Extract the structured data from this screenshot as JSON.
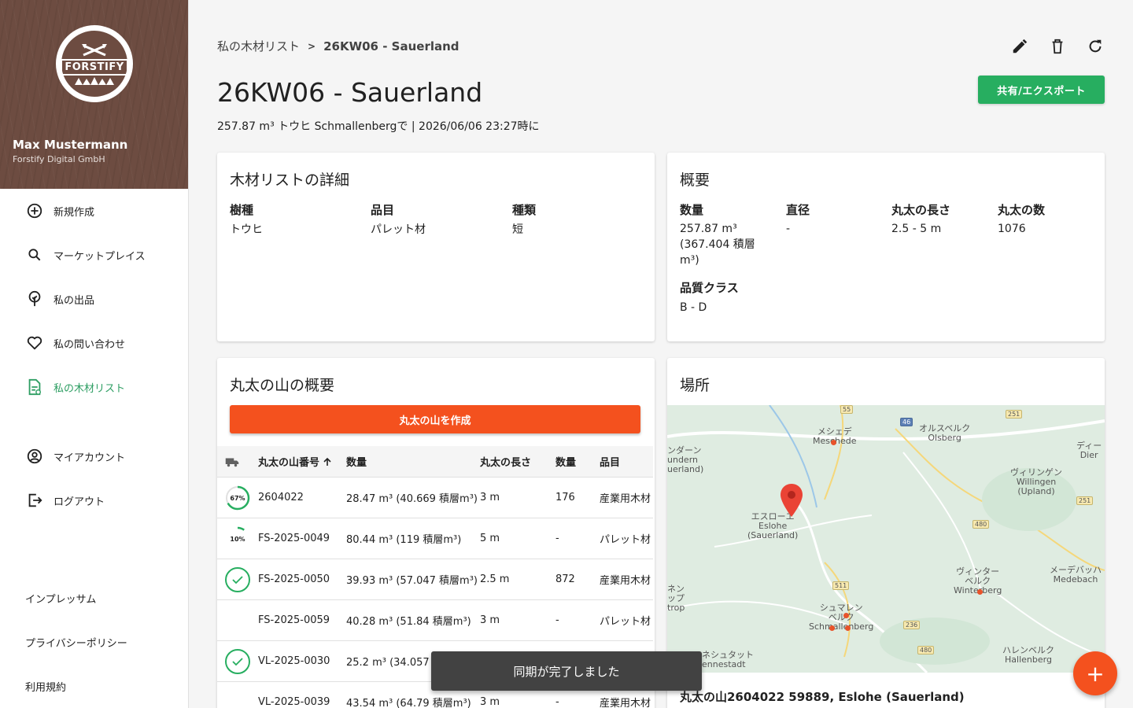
{
  "colors": {
    "brand_brown": "#6d4c41",
    "accent_green": "#27ae60",
    "accent_orange": "#f4511e"
  },
  "sidebar": {
    "logo_text": "FORSTIFY",
    "user_name": "Max Mustermann",
    "user_company": "Forstify Digital GmbH",
    "items": [
      {
        "label": "新規作成",
        "icon": "add-circle-icon"
      },
      {
        "label": "マーケットプレイス",
        "icon": "search-icon"
      },
      {
        "label": "私の出品",
        "icon": "tree-icon"
      },
      {
        "label": "私の問い合わせ",
        "icon": "heart-icon"
      },
      {
        "label": "私の木材リスト",
        "icon": "document-icon"
      },
      {
        "label": "マイアカウント",
        "icon": "account-icon"
      },
      {
        "label": "ログアウト",
        "icon": "logout-icon"
      }
    ],
    "footer": [
      "インプレッサム",
      "プライバシーポリシー",
      "利用規約"
    ]
  },
  "breadcrumb": {
    "parent": "私の木材リスト",
    "separator": ">",
    "current": "26KW06 - Sauerland"
  },
  "header": {
    "title": "26KW06 - Sauerland",
    "subtitle": "257.87 m³ トウヒ Schmallenbergで | 2026/06/06 23:27時に",
    "share_label": "共有/エクスポート"
  },
  "details": {
    "title": "木材リストの詳細",
    "fields": [
      {
        "label": "樹種",
        "value": "トウヒ"
      },
      {
        "label": "品目",
        "value": "パレット材"
      },
      {
        "label": "種類",
        "value": "短"
      }
    ]
  },
  "summary": {
    "title": "概要",
    "quantity_label": "数量",
    "quantity_value": "257.87 m³ (367.404 積層 m³)",
    "diameter_label": "直径",
    "diameter_value": "-",
    "length_label": "丸太の長さ",
    "length_value": "2.5 - 5 m",
    "count_label": "丸太の数",
    "count_value": "1076",
    "quality_label": "品質クラス",
    "quality_value": "B - D"
  },
  "piles": {
    "title": "丸太の山の概要",
    "create_label": "丸太の山を作成",
    "headers": {
      "number": "丸太の山番号",
      "volume": "数量",
      "length": "丸太の長さ",
      "count": "数量",
      "item": "品目"
    },
    "rows": [
      {
        "status": "67%",
        "progress": 0.67,
        "number": "2604022",
        "volume": "28.47 m³ (40.669 積層m³)",
        "length": "3 m",
        "count": "176",
        "item": "産業用木材"
      },
      {
        "status": "10%",
        "progress": 0.1,
        "number": "FS-2025-0049",
        "volume": "80.44 m³ (119 積層m³)",
        "length": "5 m",
        "count": "-",
        "item": "パレット材"
      },
      {
        "status": "done",
        "number": "FS-2025-0050",
        "volume": "39.93 m³ (57.047 積層m³)",
        "length": "2.5 m",
        "count": "872",
        "item": "産業用木材"
      },
      {
        "status": "",
        "number": "FS-2025-0059",
        "volume": "40.28 m³ (51.84 積層m³)",
        "length": "3 m",
        "count": "-",
        "item": "パレット材"
      },
      {
        "status": "done",
        "number": "VL-2025-0030",
        "volume": "25.2 m³ (34.057 積層m³)",
        "length": "",
        "count": "",
        "item": ""
      },
      {
        "status": "",
        "number": "VL-2025-0039",
        "volume": "43.54 m³ (64.79 積層m³)",
        "length": "3 m",
        "count": "-",
        "item": "産業用木材"
      }
    ]
  },
  "location": {
    "title": "場所",
    "text": "丸太の山2604022 59889, Eslohe (Sauerland)",
    "map_labels": {
      "meschede": "メシェデ\nMeschede",
      "olsberg": "オルスベルク\nOlsberg",
      "eslohe": "エスローエ\nEslohe\n(Sauerland)",
      "willingen": "ヴィリンゲン\nWillingen\n(Upland)",
      "winterberg": "ヴィンター\nベルク\nWinterberg",
      "medebach": "メーデバッハ\nMedebach",
      "schmallenberg": "シュマレン\nベルク\nSchmallenberg",
      "hallenberg": "ハレンベルク\nHallenberg",
      "sundern": "ンダーン\nundern\nuerland)",
      "dier": "ディー\nDier",
      "finnentrop": "ネン\nップ\ntrop",
      "lennestadt": "ネシュタット\nennestadt"
    },
    "road_shields": [
      "55",
      "46",
      "251",
      "251",
      "480",
      "511",
      "236",
      "480"
    ]
  },
  "toast": "同期が完了しました",
  "fab": "+"
}
